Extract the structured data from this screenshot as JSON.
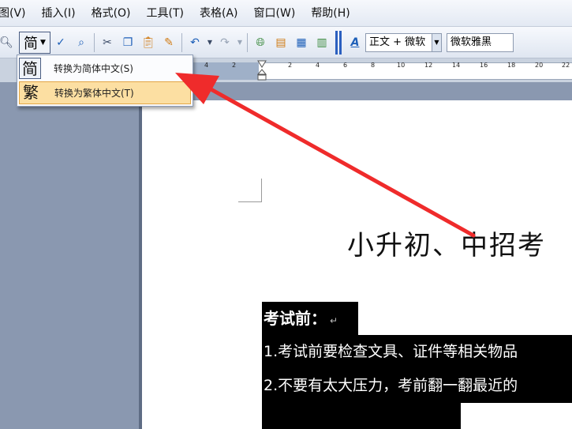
{
  "menubar": {
    "items": [
      {
        "label": "图(V)"
      },
      {
        "label": "插入(I)"
      },
      {
        "label": "格式(O)"
      },
      {
        "label": "工具(T)"
      },
      {
        "label": "表格(A)"
      },
      {
        "label": "窗口(W)"
      },
      {
        "label": "帮助(H)"
      }
    ]
  },
  "toolbar": {
    "convert_glyph": "简",
    "style_value": "正文 + 微软",
    "font_value": "微软雅黑",
    "font_style_glyph": "A"
  },
  "convert_menu": {
    "items": [
      {
        "glyph": "简",
        "label": "转换为简体中文(S)"
      },
      {
        "glyph": "繁",
        "label": "转换为繁体中文(T)"
      }
    ],
    "highlighted_index": 1
  },
  "ruler": {
    "left_numbers": [
      "4",
      "2"
    ],
    "right_numbers": [
      "2",
      "4",
      "6",
      "8",
      "10",
      "12",
      "14",
      "16",
      "18",
      "20",
      "22"
    ]
  },
  "document": {
    "title": "小升初、中招考",
    "section_heading": "考试前：",
    "lines": [
      "1.考试前要检查文具、证件等相关物品",
      "2.不要有太大压力，考前翻一翻最近的"
    ],
    "paragraph_mark": "↵"
  },
  "annotation": {
    "arrow_color": "#ef2b2b"
  }
}
